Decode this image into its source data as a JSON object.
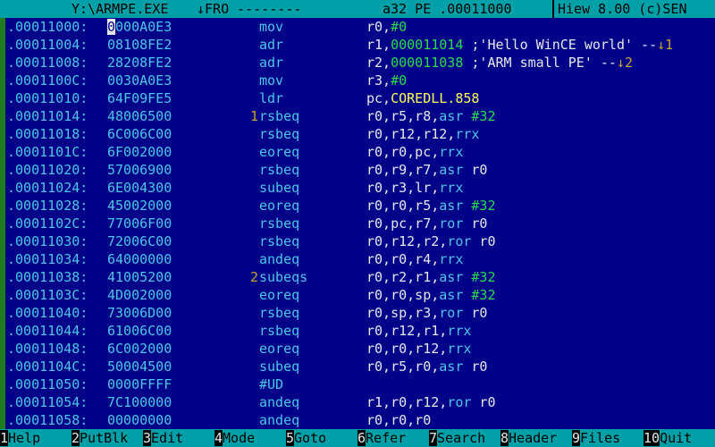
{
  "titlebar": {
    "path": "Y:\\ARMPE.EXE",
    "mode": "↓FRO --------",
    "info": "a32 PE .00011000",
    "version": "Hiew 8.00 (c)SEN"
  },
  "cursor": {
    "row": 0,
    "char": 0
  },
  "lines": [
    {
      "addr": ".00011000:",
      "hex": "0000A0E3",
      "ref": "",
      "mnemonic": "mov",
      "operands": [
        {
          "t": "r0,",
          "c": "white"
        },
        {
          "t": "#0",
          "c": "green"
        }
      ]
    },
    {
      "addr": ".00011004:",
      "hex": "08108FE2",
      "ref": "",
      "mnemonic": "adr",
      "operands": [
        {
          "t": "r1,",
          "c": "white"
        },
        {
          "t": "000011014",
          "c": "green"
        },
        {
          "t": " ;'Hello WinCE world' --",
          "c": "white"
        },
        {
          "t": "↓1",
          "c": "brown"
        }
      ]
    },
    {
      "addr": ".00011008:",
      "hex": "28208FE2",
      "ref": "",
      "mnemonic": "adr",
      "operands": [
        {
          "t": "r2,",
          "c": "white"
        },
        {
          "t": "000011038",
          "c": "green"
        },
        {
          "t": " ;'ARM small PE' --",
          "c": "white"
        },
        {
          "t": "↓2",
          "c": "brown"
        }
      ]
    },
    {
      "addr": ".0001100C:",
      "hex": "0030A0E3",
      "ref": "",
      "mnemonic": "mov",
      "operands": [
        {
          "t": "r3,",
          "c": "white"
        },
        {
          "t": "#0",
          "c": "green"
        }
      ]
    },
    {
      "addr": ".00011010:",
      "hex": "64F09FE5",
      "ref": "",
      "mnemonic": "ldr",
      "operands": [
        {
          "t": "pc,",
          "c": "white"
        },
        {
          "t": "COREDLL.858",
          "c": "yellow"
        }
      ]
    },
    {
      "addr": ".00011014:",
      "hex": "48006500",
      "ref": "1",
      "mnemonic": "rsbeq",
      "operands": [
        {
          "t": "r0,r5,r8,",
          "c": "white"
        },
        {
          "t": "asr",
          "c": "cyan"
        },
        {
          "t": " ",
          "c": "white"
        },
        {
          "t": "#32",
          "c": "green"
        }
      ]
    },
    {
      "addr": ".00011018:",
      "hex": "6C006C00",
      "ref": "",
      "mnemonic": "rsbeq",
      "operands": [
        {
          "t": "r0,r12,r12,",
          "c": "white"
        },
        {
          "t": "rrx",
          "c": "cyan"
        }
      ]
    },
    {
      "addr": ".0001101C:",
      "hex": "6F002000",
      "ref": "",
      "mnemonic": "eoreq",
      "operands": [
        {
          "t": "r0,r0,pc,",
          "c": "white"
        },
        {
          "t": "rrx",
          "c": "cyan"
        }
      ]
    },
    {
      "addr": ".00011020:",
      "hex": "57006900",
      "ref": "",
      "mnemonic": "rsbeq",
      "operands": [
        {
          "t": "r0,r9,r7,",
          "c": "white"
        },
        {
          "t": "asr",
          "c": "cyan"
        },
        {
          "t": " r0",
          "c": "white"
        }
      ]
    },
    {
      "addr": ".00011024:",
      "hex": "6E004300",
      "ref": "",
      "mnemonic": "subeq",
      "operands": [
        {
          "t": "r0,r3,lr,",
          "c": "white"
        },
        {
          "t": "rrx",
          "c": "cyan"
        }
      ]
    },
    {
      "addr": ".00011028:",
      "hex": "45002000",
      "ref": "",
      "mnemonic": "eoreq",
      "operands": [
        {
          "t": "r0,r0,r5,",
          "c": "white"
        },
        {
          "t": "asr",
          "c": "cyan"
        },
        {
          "t": " ",
          "c": "white"
        },
        {
          "t": "#32",
          "c": "green"
        }
      ]
    },
    {
      "addr": ".0001102C:",
      "hex": "77006F00",
      "ref": "",
      "mnemonic": "rsbeq",
      "operands": [
        {
          "t": "r0,pc,r7,",
          "c": "white"
        },
        {
          "t": "ror",
          "c": "cyan"
        },
        {
          "t": " r0",
          "c": "white"
        }
      ]
    },
    {
      "addr": ".00011030:",
      "hex": "72006C00",
      "ref": "",
      "mnemonic": "rsbeq",
      "operands": [
        {
          "t": "r0,r12,r2,",
          "c": "white"
        },
        {
          "t": "ror",
          "c": "cyan"
        },
        {
          "t": " r0",
          "c": "white"
        }
      ]
    },
    {
      "addr": ".00011034:",
      "hex": "64000000",
      "ref": "",
      "mnemonic": "andeq",
      "operands": [
        {
          "t": "r0,r0,r4,",
          "c": "white"
        },
        {
          "t": "rrx",
          "c": "cyan"
        }
      ]
    },
    {
      "addr": ".00011038:",
      "hex": "41005200",
      "ref": "2",
      "mnemonic": "subeqs",
      "operands": [
        {
          "t": "r0,r2,r1,",
          "c": "white"
        },
        {
          "t": "asr",
          "c": "cyan"
        },
        {
          "t": " ",
          "c": "white"
        },
        {
          "t": "#32",
          "c": "green"
        }
      ]
    },
    {
      "addr": ".0001103C:",
      "hex": "4D002000",
      "ref": "",
      "mnemonic": "eoreq",
      "operands": [
        {
          "t": "r0,r0,sp,",
          "c": "white"
        },
        {
          "t": "asr",
          "c": "cyan"
        },
        {
          "t": " ",
          "c": "white"
        },
        {
          "t": "#32",
          "c": "green"
        }
      ]
    },
    {
      "addr": ".00011040:",
      "hex": "73006D00",
      "ref": "",
      "mnemonic": "rsbeq",
      "operands": [
        {
          "t": "r0,sp,r3,",
          "c": "white"
        },
        {
          "t": "ror",
          "c": "cyan"
        },
        {
          "t": " r0",
          "c": "white"
        }
      ]
    },
    {
      "addr": ".00011044:",
      "hex": "61006C00",
      "ref": "",
      "mnemonic": "rsbeq",
      "operands": [
        {
          "t": "r0,r12,r1,",
          "c": "white"
        },
        {
          "t": "rrx",
          "c": "cyan"
        }
      ]
    },
    {
      "addr": ".00011048:",
      "hex": "6C002000",
      "ref": "",
      "mnemonic": "eoreq",
      "operands": [
        {
          "t": "r0,r0,r12,",
          "c": "white"
        },
        {
          "t": "rrx",
          "c": "cyan"
        }
      ]
    },
    {
      "addr": ".0001104C:",
      "hex": "50004500",
      "ref": "",
      "mnemonic": "subeq",
      "operands": [
        {
          "t": "r0,r5,r0,",
          "c": "white"
        },
        {
          "t": "asr",
          "c": "cyan"
        },
        {
          "t": " r0",
          "c": "white"
        }
      ]
    },
    {
      "addr": ".00011050:",
      "hex": "0000FFFF",
      "ref": "",
      "mnemonic": "#UD",
      "operands": []
    },
    {
      "addr": ".00011054:",
      "hex": "7C100000",
      "ref": "",
      "mnemonic": "andeq",
      "operands": [
        {
          "t": "r1,r0,r12,",
          "c": "white"
        },
        {
          "t": "ror",
          "c": "cyan"
        },
        {
          "t": " r0",
          "c": "white"
        }
      ]
    },
    {
      "addr": ".00011058:",
      "hex": "00000000",
      "ref": "",
      "mnemonic": "andeq",
      "operands": [
        {
          "t": "r0,r0,r0",
          "c": "white"
        }
      ]
    }
  ],
  "fkeys": [
    {
      "num": "1",
      "label": "Help"
    },
    {
      "num": "2",
      "label": "PutBlk"
    },
    {
      "num": "3",
      "label": "Edit"
    },
    {
      "num": "4",
      "label": "Mode"
    },
    {
      "num": "5",
      "label": "Goto"
    },
    {
      "num": "6",
      "label": "Refer"
    },
    {
      "num": "7",
      "label": "Search"
    },
    {
      "num": "8",
      "label": "Header"
    },
    {
      "num": "9",
      "label": "Files"
    },
    {
      "num": "10",
      "label": "Quit"
    }
  ]
}
